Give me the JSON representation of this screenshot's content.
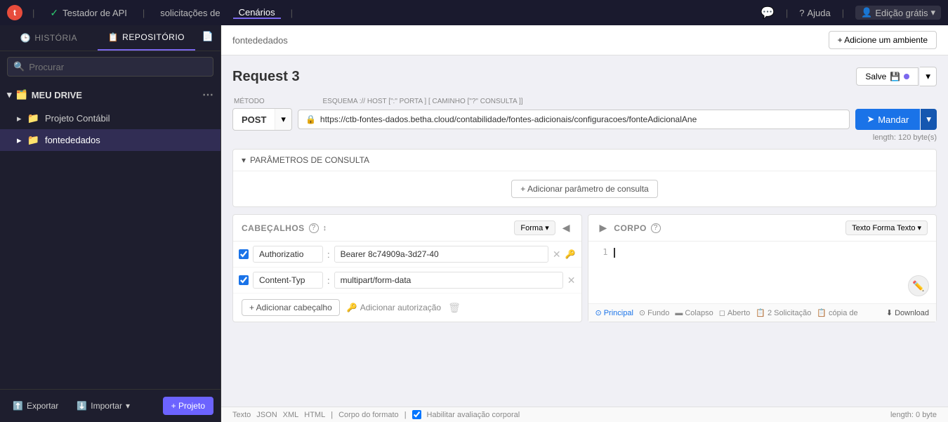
{
  "topnav": {
    "logo": "t",
    "dividers": [
      "|",
      "|",
      "|"
    ],
    "items": [
      {
        "id": "testador",
        "label": "Testador de API",
        "has_check": true
      },
      {
        "id": "solicitacoes",
        "label": "solicitações de"
      },
      {
        "id": "cenarios",
        "label": "Cenários"
      }
    ],
    "right": {
      "chat_icon": "💬",
      "help_label": "Ajuda",
      "edition_label": "Edição grátis"
    }
  },
  "sidebar": {
    "tabs": [
      {
        "id": "historia",
        "label": "HISTÓRIA",
        "icon": "🕒"
      },
      {
        "id": "repositorio",
        "label": "REPOSITÓRIO",
        "icon": "📋",
        "active": true
      }
    ],
    "export_icon": "📄",
    "search_placeholder": "Procurar",
    "my_drive_label": "MEU DRIVE",
    "items": [
      {
        "id": "projeto-contabil",
        "label": "Projeto Contábil",
        "icon": "📁"
      },
      {
        "id": "fontededados",
        "label": "fontededados",
        "icon": "📁",
        "active": true
      }
    ],
    "footer": {
      "export_label": "Exportar",
      "import_label": "Importar",
      "add_project_label": "+ Projeto"
    }
  },
  "content": {
    "topbar": {
      "breadcrumb": "fontededados",
      "add_env_label": "+ Adicione um ambiente"
    },
    "request": {
      "title": "Request 3",
      "save_label": "Salve",
      "method_label": "POST",
      "url": "https://ctb-fontes-dados.betha.cloud/contabilidade/fontes-adicionais/configuracoes/fonteAdicionalAne",
      "url_length": "length: 120 byte(s)",
      "send_label": "Mandar",
      "schema_hint": "ESQUEMA :// HOST [\":\" PORTA ] [ CAMINHO [\"?\" CONSULTA ]]",
      "method_label_full": "MÉTODO",
      "params": {
        "section_label": "PARÂMETROS DE CONSULTA",
        "add_btn": "+ Adicionar parâmetro de consulta"
      },
      "headers": {
        "section_label": "CABEÇALHOS",
        "format_btn": "Forma",
        "rows": [
          {
            "id": "auth-row",
            "checked": true,
            "key": "Authorizatio",
            "value": "Bearer 8c74909a-3d27-40"
          },
          {
            "id": "content-type-row",
            "checked": true,
            "key": "Content-Typ",
            "value": "multipart/form-data"
          }
        ],
        "add_header_btn": "+ Adicionar cabeçalho",
        "add_auth_btn": "Adicionar autorização"
      },
      "body": {
        "section_label": "CORPO",
        "format_btn": "Texto Forma Texto",
        "line_number": "1",
        "footer": {
          "principal": "Principal",
          "fundo": "Fundo",
          "colapso": "Colapso",
          "aberto": "Aberto",
          "solicitacao": "2 Solicitação",
          "copia_de": "cópia de",
          "download": "Download",
          "length_label": "length: 0 byte"
        }
      }
    },
    "statusbar": {
      "items": [
        "Texto",
        "JSON",
        "XML",
        "HTML",
        "|",
        "Corpo do formato",
        "|"
      ],
      "checkbox_label": "Habilitar avaliação corporal"
    }
  }
}
